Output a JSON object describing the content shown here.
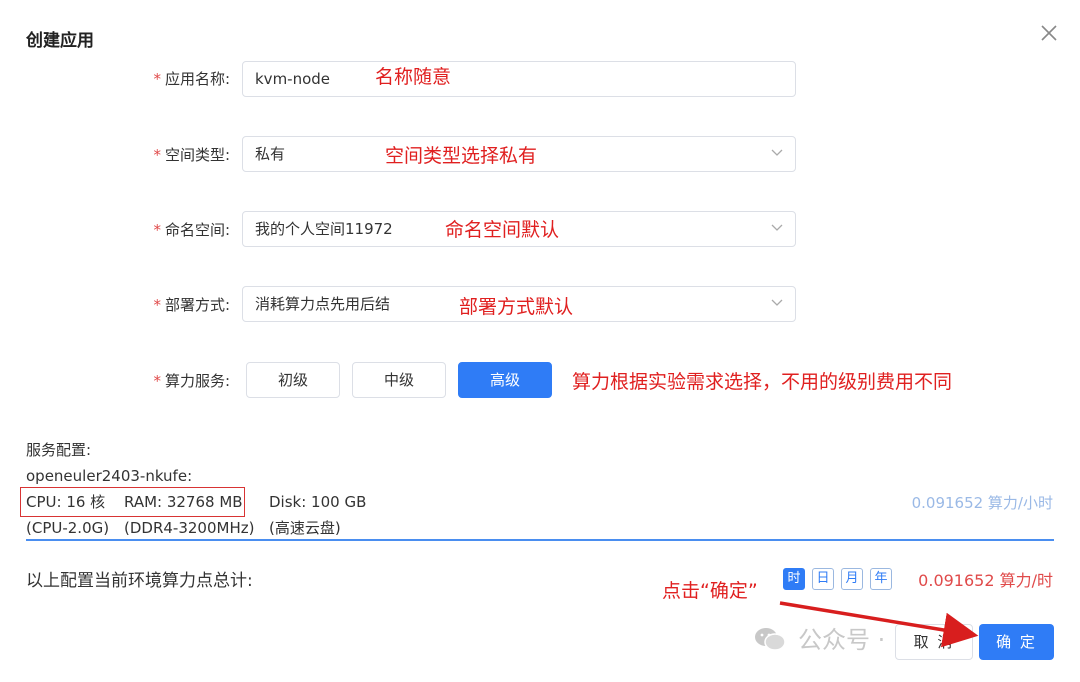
{
  "dialog": {
    "title": "创建应用",
    "close_icon": "close-icon"
  },
  "form": {
    "app_name": {
      "label": "应用名称:",
      "value": "kvm-node"
    },
    "space_type": {
      "label": "空间类型:",
      "value": "私有"
    },
    "namespace": {
      "label": "命名空间:",
      "value": "我的个人空间11972"
    },
    "deploy_mode": {
      "label": "部署方式:",
      "value": "消耗算力点先用后结"
    },
    "compute_service": {
      "label": "算力服务:",
      "levels": [
        "初级",
        "中级",
        "高级"
      ],
      "selected": "高级"
    },
    "required_mark": "*"
  },
  "annotations": {
    "name": "名称随意",
    "space_type": "空间类型选择私有",
    "namespace": "命名空间默认",
    "deploy_mode": "部署方式默认",
    "compute": "算力根据实验需求选择，不用的级别费用不同",
    "click_confirm": "点击“确定”"
  },
  "service_config": {
    "heading": "服务配置:",
    "image": "openeuler2403-nkufe:",
    "cpu": "CPU: 16 核",
    "ram": "RAM: 32768 MB",
    "disk": "Disk: 100 GB",
    "cpu_detail": "(CPU-2.0G)",
    "ram_detail": "(DDR4-3200MHz)",
    "disk_detail": "(高速云盘)",
    "price_per_hour": "0.091652 算力/小时"
  },
  "summary": {
    "label": "以上配置当前环境算力点总计:",
    "periods": [
      "时",
      "日",
      "月",
      "年"
    ],
    "selected_period": "时",
    "total": "0.091652 算力/时"
  },
  "footer": {
    "cancel_label": "取 消",
    "confirm_label": "确 定"
  },
  "watermark": {
    "text": "公众号 ·"
  },
  "colors": {
    "primary": "#2f7cf6",
    "annotation": "#e02020",
    "required": "#e04a4a"
  }
}
